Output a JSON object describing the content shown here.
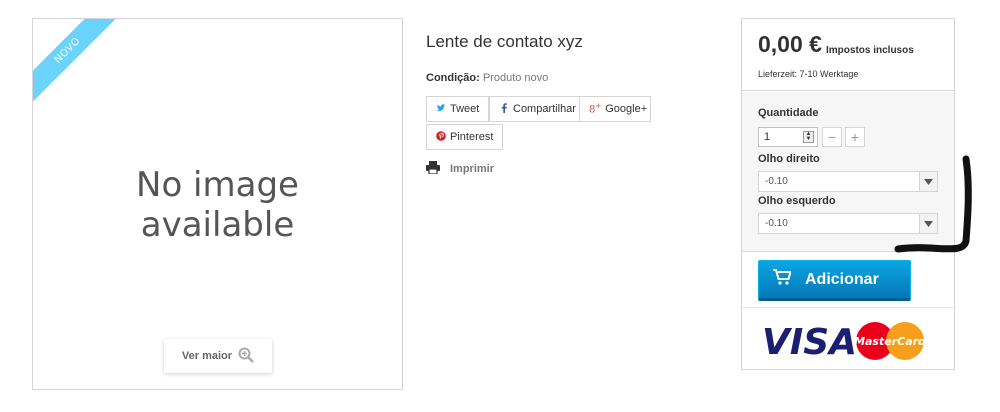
{
  "image_panel": {
    "badge": "NOVO",
    "no_image_line1": "No image",
    "no_image_line2": "available",
    "view_larger": "Ver maior",
    "zoom_icon": "zoom-in-icon"
  },
  "product": {
    "title": "Lente de contato xyz",
    "condition_label": "Condição:",
    "condition_value": "Produto novo",
    "share": {
      "tweet": "Tweet",
      "facebook": "Compartilhar",
      "google": "Google+",
      "pinterest": "Pinterest"
    },
    "print": "Imprimir"
  },
  "buy_box": {
    "price": "0,00 €",
    "tax_note": "Impostos inclusos",
    "delivery": "Lieferzeit: 7-10 Werktage",
    "quantity_label": "Quantidade",
    "quantity_value": "1",
    "right_eye_label": "Olho direito",
    "right_eye_value": "-0.10",
    "left_eye_label": "Olho esquerdo",
    "left_eye_value": "-0.10",
    "add_button": "Adicionar",
    "payment_logos": [
      "VISA",
      "MasterCard"
    ]
  },
  "colors": {
    "ribbon": "#6ad4ff",
    "add_button": "#0a89c9",
    "twitter": "#1da1f2",
    "facebook": "#3b5998",
    "google": "#dd4b39",
    "pinterest": "#cb2027",
    "visa": "#1a1f71",
    "mastercard_red": "#eb001b",
    "mastercard_orange": "#f79e1b"
  }
}
